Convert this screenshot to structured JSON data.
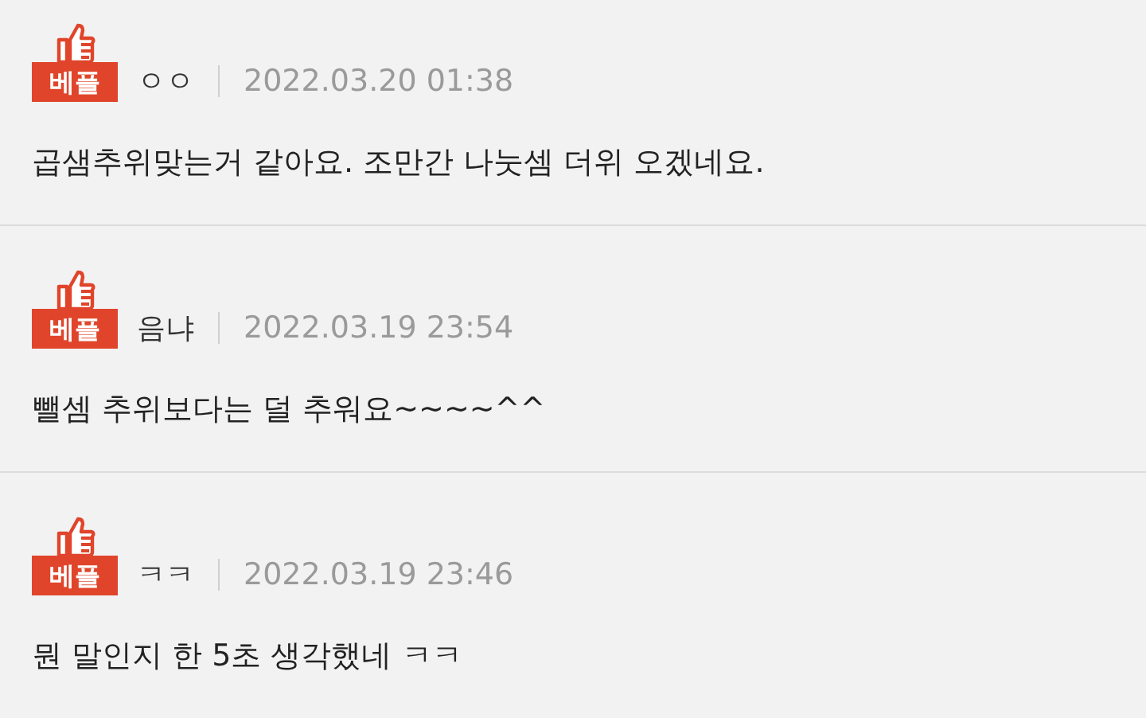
{
  "comments": [
    {
      "badge": "베플",
      "author": "ㅇㅇ",
      "date": "2022.03.20 01:38",
      "text": "곱샘추위맞는거 같아요. 조만간 나눗셈 더위 오겠네요."
    },
    {
      "badge": "베플",
      "author": "음냐",
      "date": "2022.03.19 23:54",
      "text": "뺄셈 추위보다는 덜 추워요~~~~^^"
    },
    {
      "badge": "베플",
      "author": "ㅋㅋ",
      "date": "2022.03.19 23:46",
      "text": "뭔 말인지 한 5초 생각했네 ㅋㅋ"
    }
  ]
}
